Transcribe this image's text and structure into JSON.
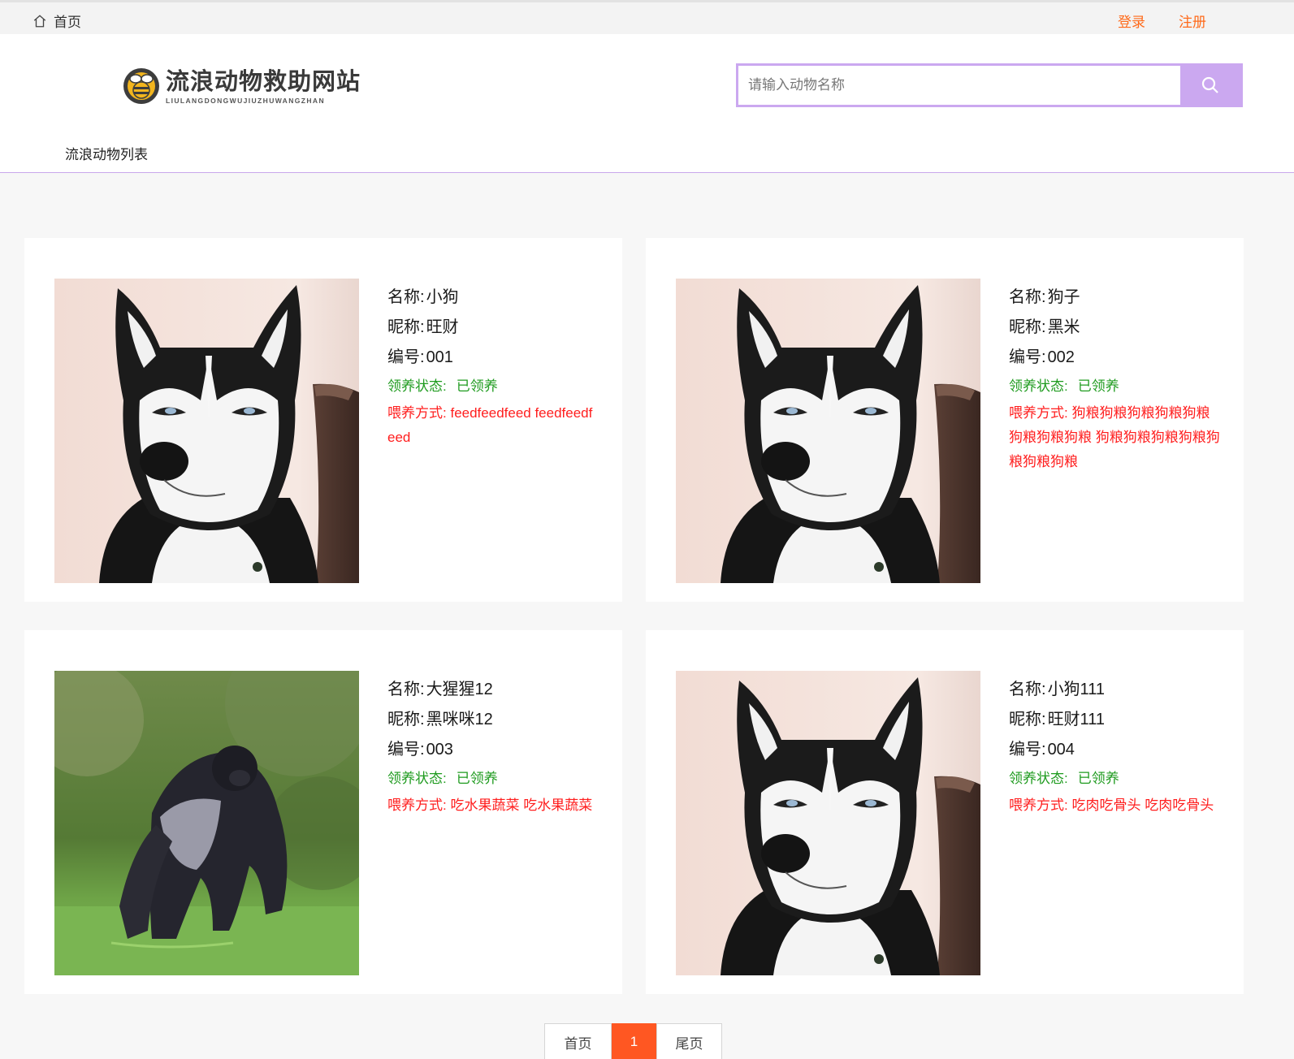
{
  "topbar": {
    "home_label": "首页",
    "login_label": "登录",
    "register_label": "注册"
  },
  "header": {
    "logo_title": "流浪动物救助网站",
    "logo_subtitle": "LIULANGDONGWUJIUZHUWANGZHAN",
    "search_placeholder": "请输入动物名称",
    "nav_label": "流浪动物列表"
  },
  "labels": {
    "name": "名称:",
    "nickname": "昵称:",
    "number": "编号:",
    "status": "领养状态:",
    "feed": "喂养方式:"
  },
  "animals": [
    {
      "name": "小狗",
      "nickname": "旺财",
      "number": "001",
      "status": "已领养",
      "feed": "feedfeedfeed feedfeedfeed",
      "image": "husky"
    },
    {
      "name": "狗子",
      "nickname": "黑米",
      "number": "002",
      "status": "已领养",
      "feed": "狗粮狗粮狗粮狗粮狗粮狗粮狗粮狗粮 狗粮狗粮狗粮狗粮狗粮狗粮狗粮",
      "image": "husky"
    },
    {
      "name": "大猩猩12",
      "nickname": "黑咪咪12",
      "number": "003",
      "status": "已领养",
      "feed": "吃水果蔬菜 吃水果蔬菜",
      "image": "gorilla"
    },
    {
      "name": "小狗111",
      "nickname": "旺财111",
      "number": "004",
      "status": "已领养",
      "feed": "吃肉吃骨头 吃肉吃骨头",
      "image": "husky"
    }
  ],
  "pagination": {
    "first_label": "首页",
    "current": "1",
    "last_label": "尾页"
  },
  "colors": {
    "accent": "#cba8f0",
    "link_orange": "#ff6a1a",
    "status_green": "#1f9b1f",
    "feed_red": "#ff1e1e",
    "page_active": "#ff5722"
  }
}
